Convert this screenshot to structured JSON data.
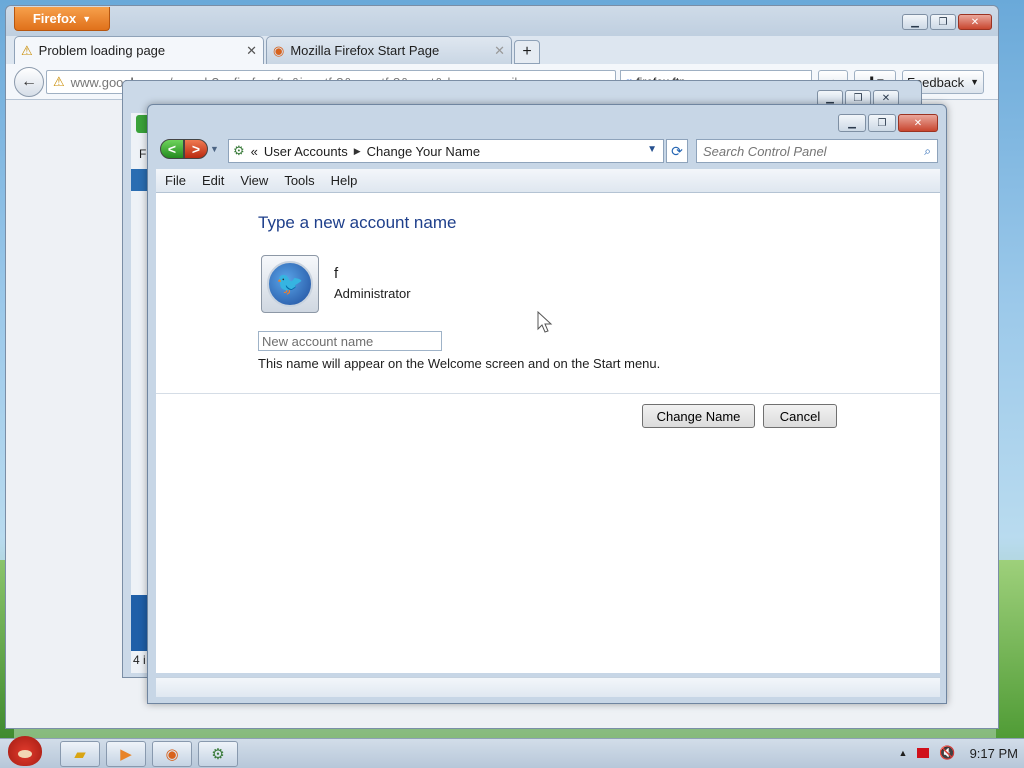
{
  "firefox": {
    "menu_label": "Firefox",
    "tabs": [
      {
        "label": "Problem loading page",
        "icon": "warning-icon"
      },
      {
        "label": "Mozilla Firefox Start Page",
        "icon": "firefox-icon"
      }
    ],
    "new_tab": "+",
    "url_host": "www.goo",
    "url_host_rest": "gle.com",
    "url_path": "/search?q=firefox+ftp&ie=utf-8&oe=utf-8&aq=t&rls=org.mozil",
    "search_value": "firefox ftp",
    "feedback_label": "Feedback"
  },
  "background_window": {
    "sidebar_letter": "F",
    "status_count": "4 i"
  },
  "control_panel": {
    "breadcrumb": {
      "prefix": "«",
      "items": [
        "User Accounts",
        "Change Your Name"
      ]
    },
    "search_placeholder": "Search Control Panel",
    "menu": [
      "File",
      "Edit",
      "View",
      "Tools",
      "Help"
    ],
    "heading": "Type a new account name",
    "account": {
      "name": "f",
      "role": "Administrator"
    },
    "new_name_placeholder": "New account name",
    "hint": "This name will appear on the Welcome screen and on the Start menu.",
    "buttons": {
      "change": "Change Name",
      "cancel": "Cancel"
    }
  },
  "taskbar": {
    "clock": "9:17 PM"
  },
  "colors": {
    "heading": "#1e3f8b",
    "firefox_orange": "#e0711b"
  }
}
